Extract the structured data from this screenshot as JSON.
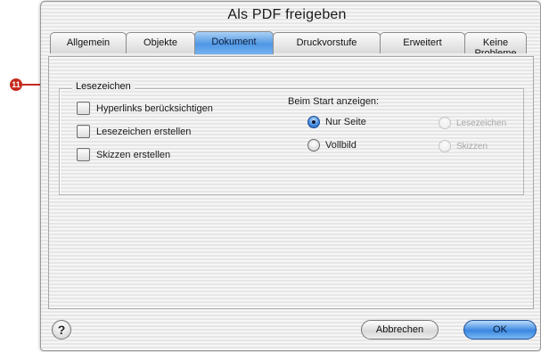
{
  "window": {
    "title": "Als PDF freigeben"
  },
  "tabs": [
    {
      "label": "Allgemein",
      "active": false
    },
    {
      "label": "Objekte",
      "active": false
    },
    {
      "label": "Dokument",
      "active": true
    },
    {
      "label": "Druckvorstufe",
      "active": false
    },
    {
      "label": "Erweitert",
      "active": false
    },
    {
      "label": "Keine Probleme",
      "active": false
    }
  ],
  "bookmarks_group": {
    "label": "Lesezeichen",
    "checkboxes": [
      {
        "label": "Hyperlinks berücksichtigen",
        "checked": false
      },
      {
        "label": "Lesezeichen erstellen",
        "checked": false
      },
      {
        "label": "Skizzen erstellen",
        "checked": false
      }
    ],
    "start_view": {
      "label": "Beim Start anzeigen:",
      "options": [
        {
          "label": "Nur Seite",
          "selected": true,
          "enabled": true
        },
        {
          "label": "Lesezeichen",
          "selected": false,
          "enabled": false
        },
        {
          "label": "Vollbild",
          "selected": false,
          "enabled": true
        },
        {
          "label": "Skizzen",
          "selected": false,
          "enabled": false
        }
      ]
    }
  },
  "buttons": {
    "help": "?",
    "cancel": "Abbrechen",
    "ok": "OK"
  },
  "callout": {
    "number": "11",
    "color": "#c62a1e"
  },
  "colors": {
    "accent": "#3a87e0"
  }
}
